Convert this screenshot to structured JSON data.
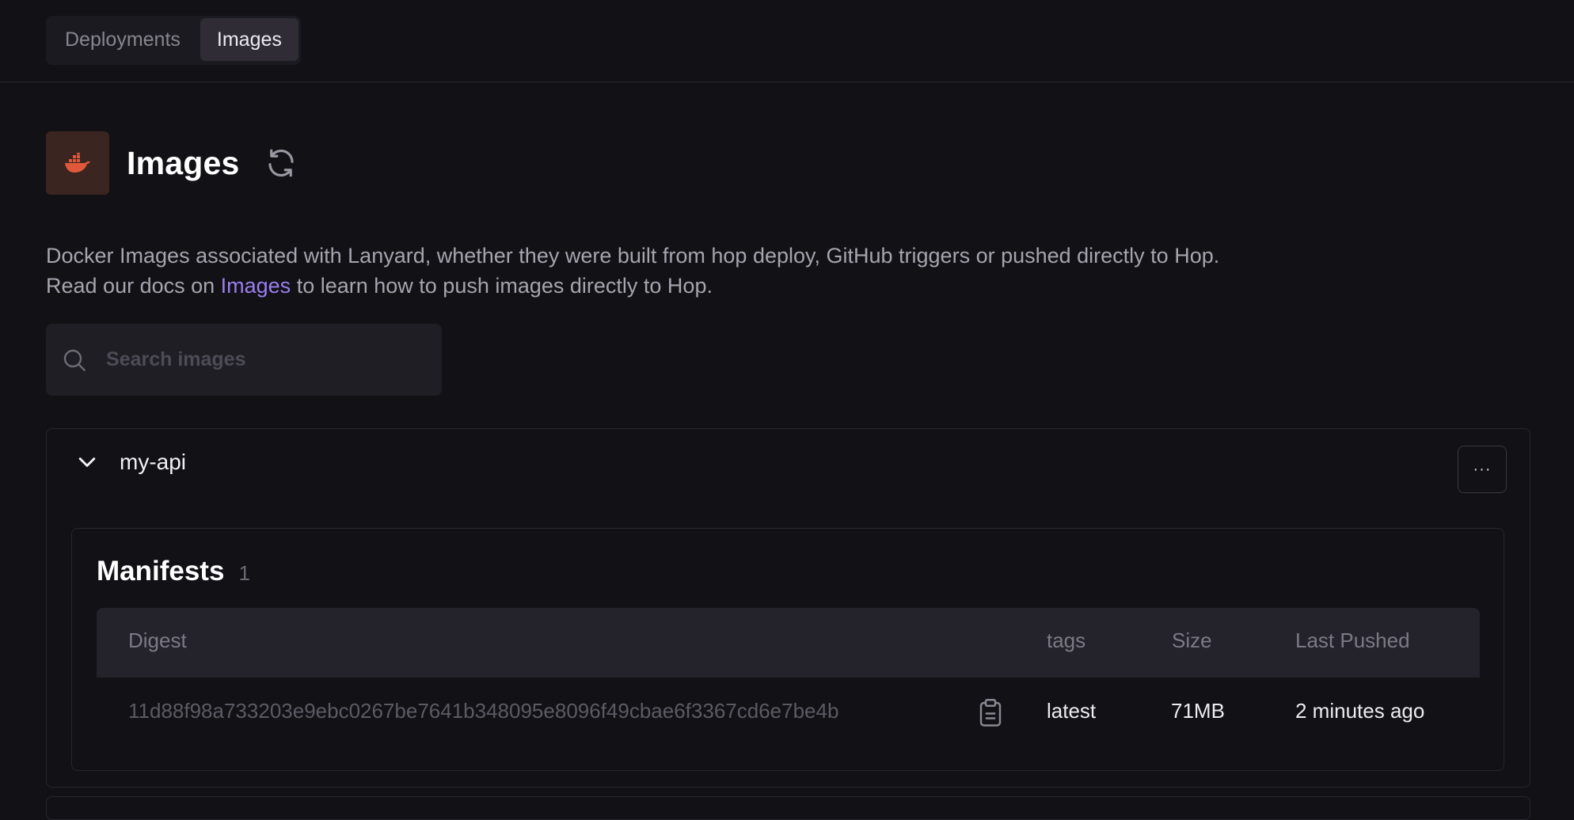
{
  "tabs": [
    {
      "label": "Deployments",
      "active": false
    },
    {
      "label": "Images",
      "active": true
    }
  ],
  "header": {
    "title": "Images",
    "badge_icon": "docker-whale-icon",
    "badge_color": "#e0583a",
    "refresh_icon": "refresh-icon"
  },
  "description": {
    "line1": "Docker Images associated with Lanyard, whether they were built from hop deploy, GitHub triggers or pushed directly to Hop.",
    "line2_prefix": "Read our docs on ",
    "line2_link": "Images",
    "line2_suffix": " to learn how to push images directly to Hop."
  },
  "search": {
    "placeholder": "Search images",
    "value": ""
  },
  "repository": {
    "name": "my-api",
    "expanded": true,
    "more_label": "···",
    "manifests": {
      "title": "Manifests",
      "count": "1",
      "columns": {
        "digest": "Digest",
        "tags": "tags",
        "size": "Size",
        "last_pushed": "Last Pushed"
      },
      "rows": [
        {
          "digest": "11d88f98a733203e9ebc0267be7641b348095e8096f49cbae6f3367cd6e7be4b",
          "tags": "latest",
          "size": "71MB",
          "last_pushed": "2 minutes ago"
        }
      ]
    }
  },
  "colors": {
    "accent_link": "#9b7ff0",
    "background": "#121116",
    "docker_orange": "#e0583a"
  }
}
